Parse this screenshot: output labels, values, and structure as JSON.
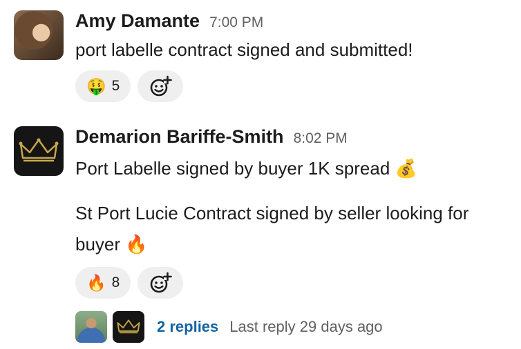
{
  "messages": [
    {
      "author": "Amy Damante",
      "time": "7:00 PM",
      "lines": [
        "port labelle contract signed and submitted!"
      ],
      "reactions": [
        {
          "emoji": "🤑",
          "count": "5"
        }
      ]
    },
    {
      "author": "Demarion Bariffe-Smith",
      "time": "8:02 PM",
      "lines": [
        "Port Labelle signed by buyer 1K spread 💰",
        "St Port Lucie Contract signed by seller looking for buyer 🔥"
      ],
      "reactions": [
        {
          "emoji": "🔥",
          "count": "8"
        }
      ],
      "thread": {
        "replies": "2 replies",
        "last_reply": "Last reply 29 days ago"
      }
    }
  ],
  "colors": {
    "link": "#1264a3",
    "reaction_bg": "#efefef",
    "muted": "#616061",
    "crown": "#c9a84a"
  },
  "icons": {
    "add_reaction": "add-reaction-icon",
    "crown": "crown-icon"
  }
}
